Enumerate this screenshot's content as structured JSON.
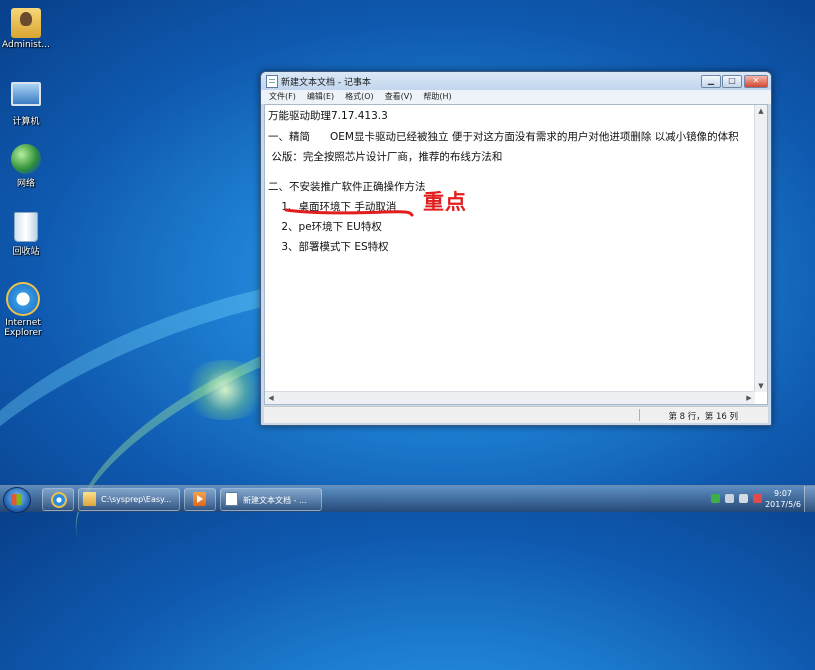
{
  "desktop": {
    "icons": [
      {
        "label": "Administ..."
      },
      {
        "label": "计算机"
      },
      {
        "label": "网络"
      },
      {
        "label": "回收站"
      },
      {
        "label": "Internet Explorer"
      }
    ]
  },
  "notepad": {
    "title": "新建文本文档 - 记事本",
    "menu": [
      "文件(F)",
      "编辑(E)",
      "格式(O)",
      "查看(V)",
      "帮助(H)"
    ],
    "lines": [
      "万能驱动助理7.17.413.3",
      "一、精简      OEM显卡驱动已经被独立 便于对这方面没有需求的用户对他进项删除 以减小镜像的体积",
      " 公版：完全按照芯片设计厂商，推荐的布线方法和",
      "",
      "二、不安装推广软件正确操作方法",
      "    1、桌面环境下 手动取消",
      "    2、pe环境下 EU特权",
      "    3、部署模式下 ES特权"
    ],
    "status": "第 8 行，第 16 列",
    "annotation": "重点",
    "annotation_color": "#e11d1d"
  },
  "taskbar": {
    "items": [
      {
        "label": "C:\\sysprep\\Easy..."
      },
      {
        "label": "新建文本文档 - ..."
      }
    ],
    "clock_time": "9:07",
    "clock_date": "2017/5/6"
  }
}
